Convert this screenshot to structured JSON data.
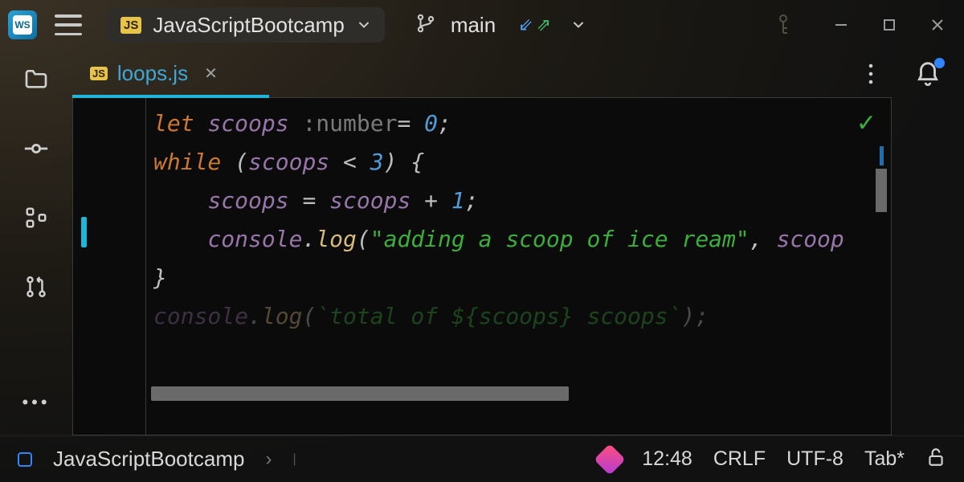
{
  "title": {
    "app_badge": "WS",
    "project_badge": "JS",
    "project_name": "JavaScriptBootcamp",
    "branch": "main"
  },
  "tabs": [
    {
      "badge": "JS",
      "filename": "loops.js",
      "active": true
    }
  ],
  "code": {
    "line1_let": "let",
    "line1_var": "scoops",
    "line1_hint": " :number",
    "line1_eq": "= ",
    "line1_val": "0",
    "line1_semi": ";",
    "line2_while": "while",
    "line2_open": " (",
    "line2_var": "scoops",
    "line2_op": " < ",
    "line2_n": "3",
    "line2_close": ") {",
    "line3_indent": "    ",
    "line3_var": "scoops",
    "line3_eq": " = ",
    "line3_var2": "scoops",
    "line3_plus": " + ",
    "line3_n": "1",
    "line3_semi": ";",
    "line4_indent": "    ",
    "line4_obj": "console",
    "line4_dot": ".",
    "line4_fn": "log",
    "line4_open": "(",
    "line4_str": "\"adding a scoop of ice ream\"",
    "line4_comma": ", ",
    "line4_arg": "scoop",
    "line5_brace": "}",
    "line6_obj": "console",
    "line6_dot": ".",
    "line6_fn": "log",
    "line6_open": "(",
    "line6_str": "`total of ${scoops} scoops`",
    "line6_close": ");"
  },
  "status": {
    "breadcrumb": "JavaScriptBootcamp",
    "time": "12:48",
    "line_ending": "CRLF",
    "encoding": "UTF-8",
    "indent": "Tab*"
  }
}
